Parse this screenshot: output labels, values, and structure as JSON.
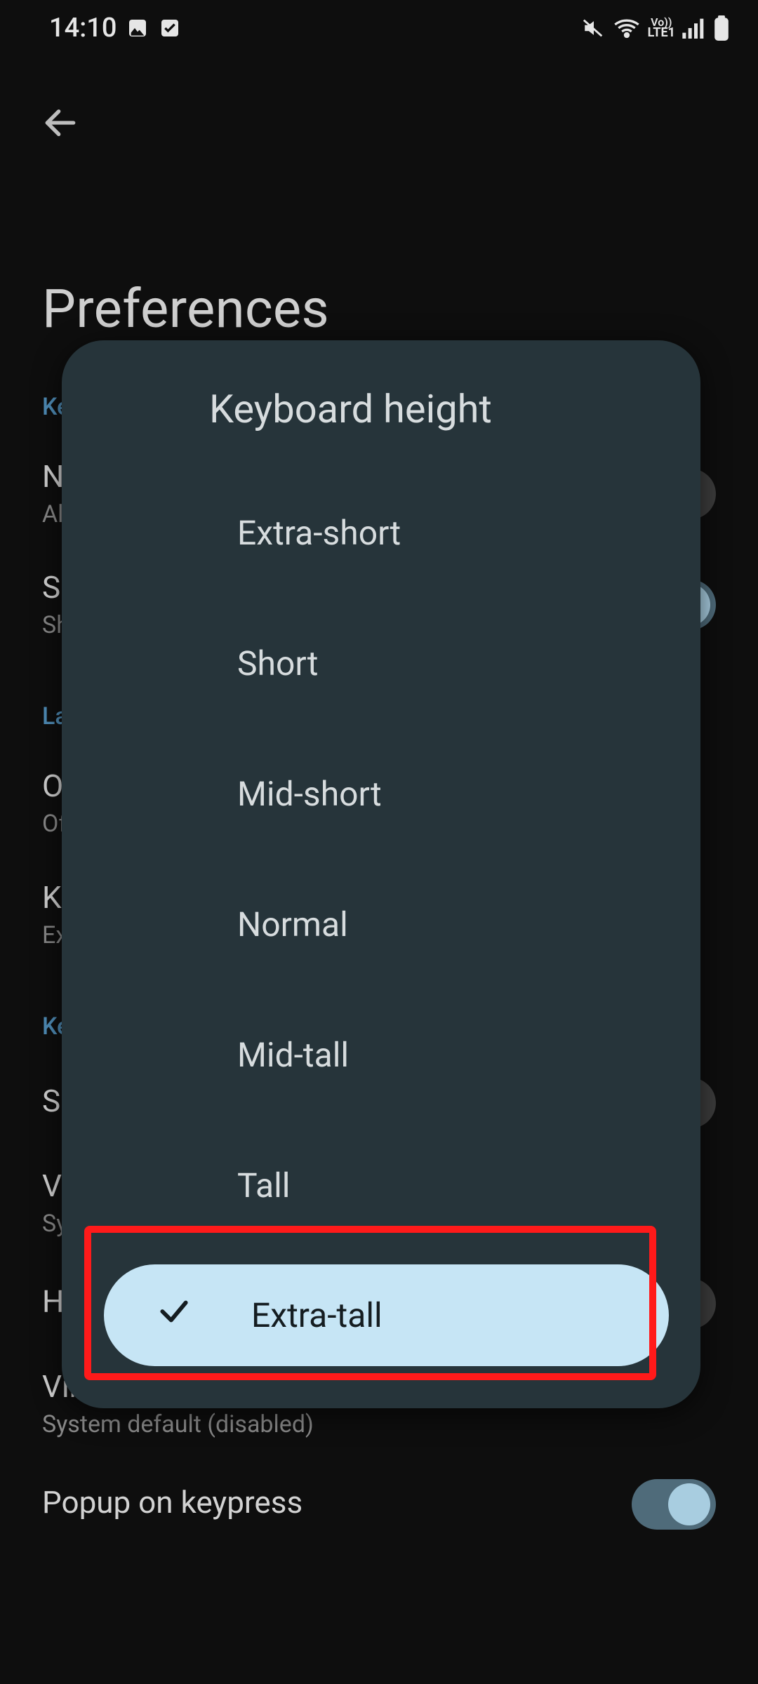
{
  "status": {
    "time": "14:10",
    "lte_label": "LTE1"
  },
  "page": {
    "title": "Preferences"
  },
  "dialog": {
    "title": "Keyboard height",
    "options": [
      "Extra-short",
      "Short",
      "Mid-short",
      "Normal",
      "Mid-tall",
      "Tall",
      "Extra-tall"
    ],
    "selected_index": 6
  },
  "background": {
    "sections": {
      "keys_label": "Keys",
      "number_row_title": "Number row",
      "number_row_sub": "Always show number row when typing with AZERTY",
      "long_press_title": "Show long-press hints",
      "long_press_sub": "Show hints for secondary characters on keys",
      "layout_label": "Layout",
      "one_handed_title": "One-handed mode",
      "one_handed_sub": "Off",
      "kb_height_title": "Keyboard height",
      "kb_height_sub": "Extra-tall",
      "keypress_label": "Keypress",
      "sound_title": "Sound on keypress",
      "vibrate_title": "Vibrate on keypress",
      "vibrate_sub": "System default",
      "haptic_title": "Haptic feedback on keypress",
      "vib_strength_title": "Vibration strength on keypress",
      "vib_strength_sub": "System default (disabled)",
      "popup_title": "Popup on keypress"
    }
  }
}
